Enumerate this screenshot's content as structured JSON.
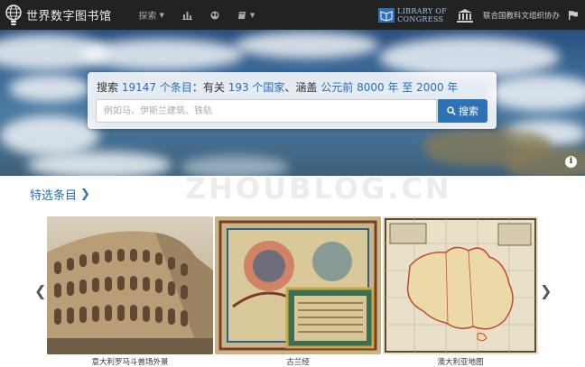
{
  "header": {
    "brand_name": "世界数字图书馆",
    "nav": {
      "explore_label": "探索"
    },
    "library_of_congress": [
      "LIBRARY OF",
      "CONGRESS"
    ],
    "unesco_label": "联合国教科文组织协办"
  },
  "search": {
    "prefix": "搜索",
    "item_count": "19147 个条目",
    "middle": "：有关",
    "country_count": "193 个国家",
    "sep": "、涵盖",
    "range": "公元前 8000 年 至 2000 年",
    "placeholder": "例如马、伊斯兰建筑、铁轨",
    "button_label": "搜索"
  },
  "watermark": "ZHOUBLOG.CN",
  "featured": {
    "title": "特选条目",
    "items": [
      {
        "caption": "意大利罗马斗兽场外景"
      },
      {
        "caption": "古兰经"
      },
      {
        "caption": "澳大利亚地图"
      }
    ]
  },
  "colors": {
    "topbar": "#222222",
    "accent": "#2a6ebb",
    "button": "#2f71b5"
  }
}
